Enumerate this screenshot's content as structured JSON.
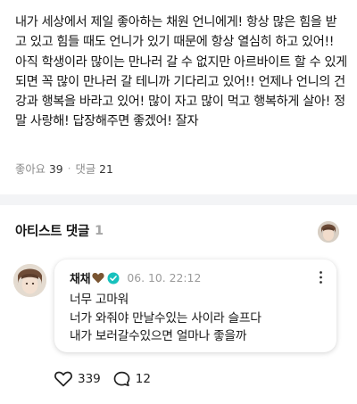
{
  "post": {
    "body": "내가 세상에서 제일 좋아하는 채원 언니에게! 항상 많은 힘을 받고 있고 힘들 때도 언니가 있기 때문에 항상 열심히 하고 있어!! 아직 학생이라 많이는 만나러 갈 수 없지만 아르바이트 할 수 있게 되면 꼭 많이 만나러 갈 테니까 기다리고 있어!! 언제나 언니의 건강과 행복을 바라고 있어! 많이 자고 많이 먹고 행복하게 살아! 정말 사랑해! 답장해주면 좋겠어! 잘자",
    "likes_label": "좋아요",
    "likes_count": "39",
    "comments_label": "댓글",
    "comments_count": "21"
  },
  "artist_comments": {
    "title": "아티스트 댓글",
    "count": "1"
  },
  "comment": {
    "author": "채채",
    "time": "06. 10. 22:12",
    "text": "너무 고마워\n너가 와줘야 만날수있는 사이라 슬프다\n내가 보러갈수있으면 얼마나 좋을까",
    "likes": "339",
    "replies": "12"
  },
  "colors": {
    "verified": "#17c1bd",
    "heart_emoji": "#7a5532",
    "divider": "#f3f4f6"
  },
  "icons": [
    "heart-icon",
    "reply-bubble-icon",
    "more-vertical-icon",
    "verified-badge-icon",
    "brown-heart-emoji"
  ]
}
